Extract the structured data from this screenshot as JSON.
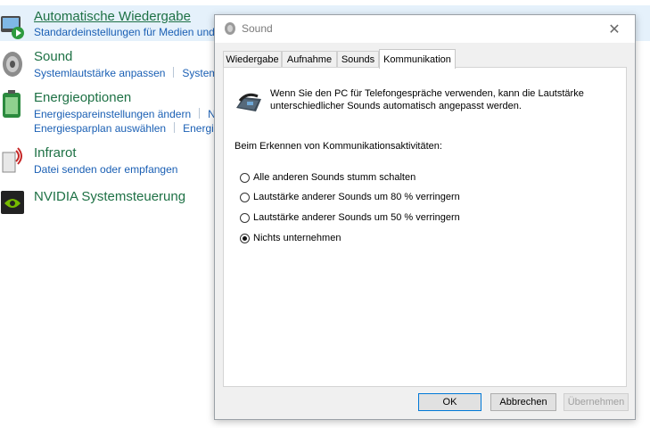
{
  "control_panel": {
    "items": [
      {
        "title": "Automatische Wiedergabe",
        "links": [
          "Standardeinstellungen für Medien und"
        ]
      },
      {
        "title": "Sound",
        "links": [
          "Systemlautstärke anpassen",
          "Systems"
        ]
      },
      {
        "title": "Energieoptionen",
        "links": [
          "Energiespareinstellungen ändern",
          "N"
        ],
        "links2": [
          "Energiesparplan auswählen",
          "Energie"
        ]
      },
      {
        "title": "Infrarot",
        "links": [
          "Datei senden oder empfangen"
        ]
      },
      {
        "title": "NVIDIA Systemsteuerung",
        "links": []
      }
    ]
  },
  "dialog": {
    "title": "Sound",
    "close_label": "✕",
    "tabs": [
      "Wiedergabe",
      "Aufnahme",
      "Sounds",
      "Kommunikation"
    ],
    "active_tab": "Kommunikation",
    "description": "Wenn Sie den PC für Telefongespräche verwenden, kann die Lautstärke unterschiedlicher Sounds automatisch angepasst werden.",
    "section_label": "Beim Erkennen von Kommunikationsaktivitäten:",
    "options": [
      {
        "label": "Alle anderen Sounds stumm schalten",
        "checked": false
      },
      {
        "label": "Lautstärke anderer Sounds um 80 % verringern",
        "checked": false
      },
      {
        "label": "Lautstärke anderer Sounds um 50 % verringern",
        "checked": false
      },
      {
        "label": "Nichts unternehmen",
        "checked": true
      }
    ],
    "buttons": {
      "ok": "OK",
      "cancel": "Abbrechen",
      "apply": "Übernehmen"
    }
  },
  "icons": {
    "autoplay": "autoplay-icon",
    "sound": "speaker-icon",
    "power": "battery-icon",
    "infrared": "infrared-icon",
    "nvidia": "nvidia-icon",
    "title": "speaker-icon",
    "phone": "telephone-icon"
  },
  "colors": {
    "link_title": "#1e7145",
    "link": "#1a5fb4",
    "selection": "#e5f1fb",
    "focus": "#0078d7"
  }
}
